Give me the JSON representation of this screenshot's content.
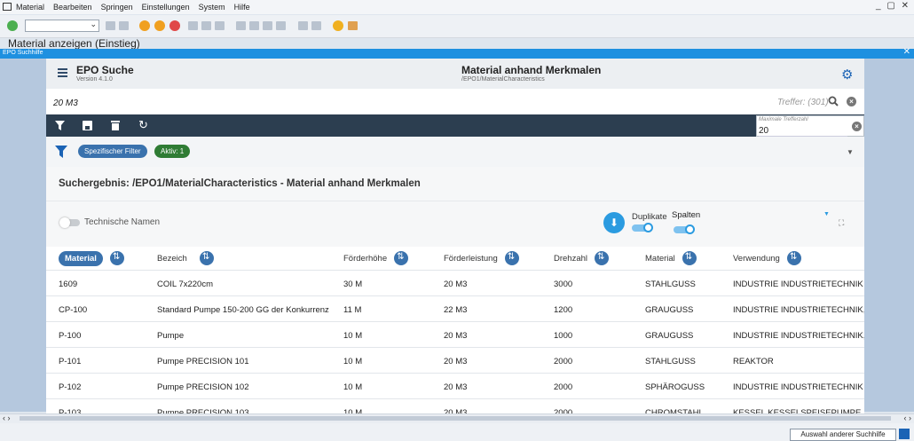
{
  "menubar": {
    "items": [
      "Material",
      "Bearbeiten",
      "Springen",
      "Einstellungen",
      "System",
      "Hilfe"
    ],
    "window_controls": "_ ▢ ✕"
  },
  "sap": {
    "screen_title": "Material anzeigen (Einstieg)"
  },
  "popup": {
    "title": "EPO Suchhilfe",
    "close": "✕"
  },
  "epo": {
    "title": "EPO Suche",
    "version": "Version 4.1.0",
    "context_title": "Material anhand Merkmalen",
    "context_path": "/EPO1/MaterialCharacteristics"
  },
  "search": {
    "value": "20 M3",
    "hits": "Treffer: (301)"
  },
  "max_hits": {
    "label": "Maximale Trefferzahl",
    "value": "20"
  },
  "filters": {
    "specific": "Spezifischer Filter",
    "active": "Aktiv: 1"
  },
  "result": {
    "title": "Suchergebnis: /EPO1/MaterialCharacteristics - Material anhand Merkmalen",
    "tech_names": "Technische Namen",
    "duplicates": "Duplikate",
    "columns_label": "Spalten"
  },
  "table": {
    "columns": [
      "Material",
      "Bezeich",
      "Förderhöhe",
      "Förderleistung",
      "Drehzahl",
      "Material",
      "Verwendung"
    ],
    "rows": [
      [
        "1609",
        "COIL 7x220cm",
        "30 M",
        "20 M3",
        "3000",
        "STAHLGUSS",
        "INDUSTRIE INDUSTRIETECHNIK"
      ],
      [
        "CP-100",
        "Standard Pumpe 150-200 GG der Konkurrenz",
        "11 M",
        "22 M3",
        "1200",
        "GRAUGUSS",
        "INDUSTRIE INDUSTRIETECHNIK, KES"
      ],
      [
        "P-100",
        "Pumpe",
        "10 M",
        "20 M3",
        "1000",
        "GRAUGUSS",
        "INDUSTRIE INDUSTRIETECHNIK, KES"
      ],
      [
        "P-101",
        "Pumpe PRECISION 101",
        "10 M",
        "20 M3",
        "2000",
        "STAHLGUSS",
        "REAKTOR"
      ],
      [
        "P-102",
        "Pumpe PRECISION 102",
        "10 M",
        "20 M3",
        "2000",
        "SPHÄROGUSS",
        "INDUSTRIE INDUSTRIETECHNIK"
      ],
      [
        "P-103",
        "Pumpe PRECISION 103",
        "10 M",
        "20 M3",
        "2000",
        "CHROMSTAHL",
        "KESSEL KESSELSPEISEPUMPE"
      ]
    ]
  },
  "footer": {
    "other_help_button": "Auswahl anderer Suchhilfe"
  },
  "colors": {
    "accent": "#1e90e0",
    "brand_blue": "#3a72ad",
    "dark_bar": "#2c3e50",
    "active_green": "#2f7c34"
  }
}
